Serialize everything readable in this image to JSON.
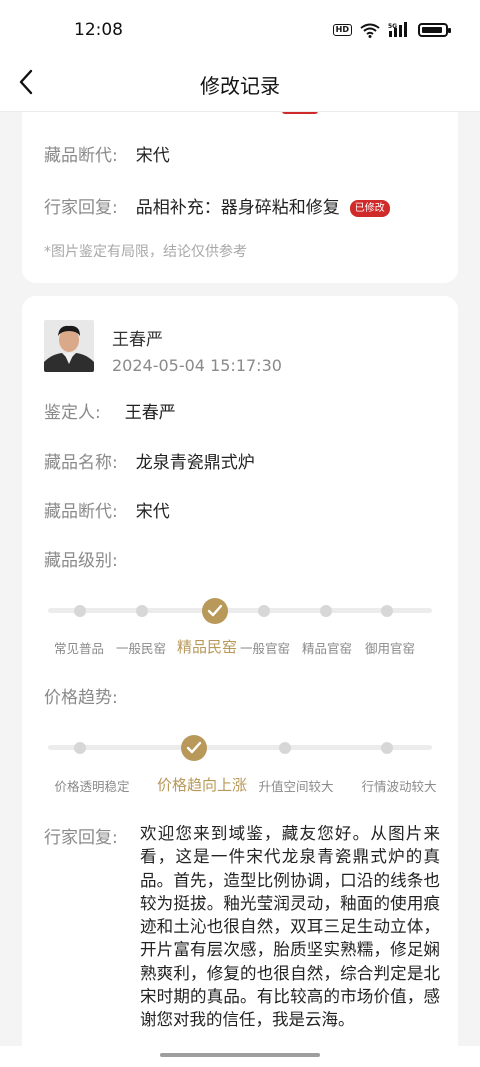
{
  "status_bar": {
    "time": "12:08",
    "hd_label": "HD",
    "net_label": "5G"
  },
  "nav": {
    "title": "修改记录"
  },
  "record_prev": {
    "period_label": "藏品断代:",
    "period_value": "宋代",
    "reply_label": "行家回复:",
    "reply_value": "品相补充：器身碎粘和修复",
    "modified_badge": "已修改",
    "disclaimer": "*图片鉴定有局限，结论仅供参考"
  },
  "record": {
    "expert_name": "王春严",
    "timestamp": "2024-05-04 15:17:30",
    "appraiser_label": "鉴定人:",
    "appraiser_value": "王春严",
    "item_name_label": "藏品名称:",
    "item_name_value": "龙泉青瓷鼎式炉",
    "period_label": "藏品断代:",
    "period_value": "宋代",
    "grade_label": "藏品级别:",
    "grade_scale": [
      "常见普品",
      "一般民窑",
      "精品民窑",
      "一般官窑",
      "精品官窑",
      "御用官窑"
    ],
    "grade_selected": "精品民窑",
    "price_label": "价格趋势:",
    "price_scale": [
      "价格透明稳定",
      "价格趋向上涨",
      "升值空间较大",
      "行情波动较大"
    ],
    "price_selected": "价格趋向上涨",
    "reply_label": "行家回复:",
    "reply_text": "欢迎您来到域鉴，藏友您好。从图片来看，这是一件宋代龙泉青瓷鼎式炉的真品。首先，造型比例协调，口沿的线条也较为挺拔。釉光莹润灵动，釉面的使用痕迹和土沁也很自然，双耳三足生动立体，开片富有层次感，胎质坚实熟糯，修足娴熟爽利，修复的也很自然，综合判定是北宋时期的真品。有比较高的市场价值，感谢您对我的信任，我是云海。"
  },
  "colors": {
    "accent": "#b8995a",
    "badge": "#d12a2a"
  }
}
